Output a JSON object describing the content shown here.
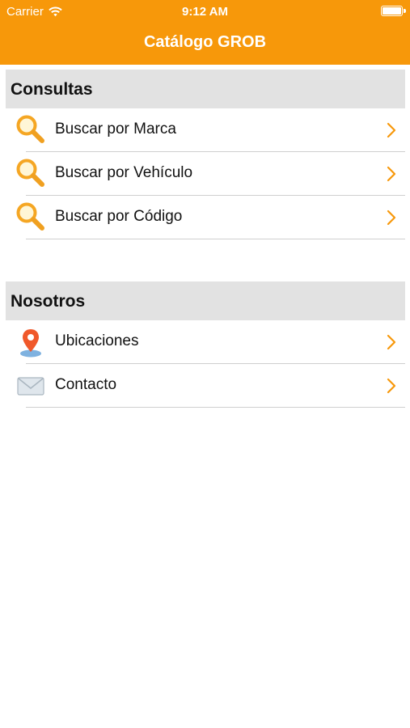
{
  "status_bar": {
    "carrier": "Carrier",
    "time": "9:12 AM"
  },
  "nav": {
    "title": "Catálogo GROB"
  },
  "sections": [
    {
      "title": "Consultas",
      "rows": [
        {
          "label": "Buscar por Marca",
          "icon": "search-icon"
        },
        {
          "label": "Buscar por Vehículo",
          "icon": "search-icon"
        },
        {
          "label": "Buscar por Código",
          "icon": "search-icon"
        }
      ]
    },
    {
      "title": "Nosotros",
      "rows": [
        {
          "label": "Ubicaciones",
          "icon": "location-pin-icon"
        },
        {
          "label": "Contacto",
          "icon": "mail-icon"
        }
      ]
    }
  ],
  "colors": {
    "accent": "#f7980a",
    "section_bg": "#e2e2e2",
    "separator": "#cfcfcf"
  }
}
